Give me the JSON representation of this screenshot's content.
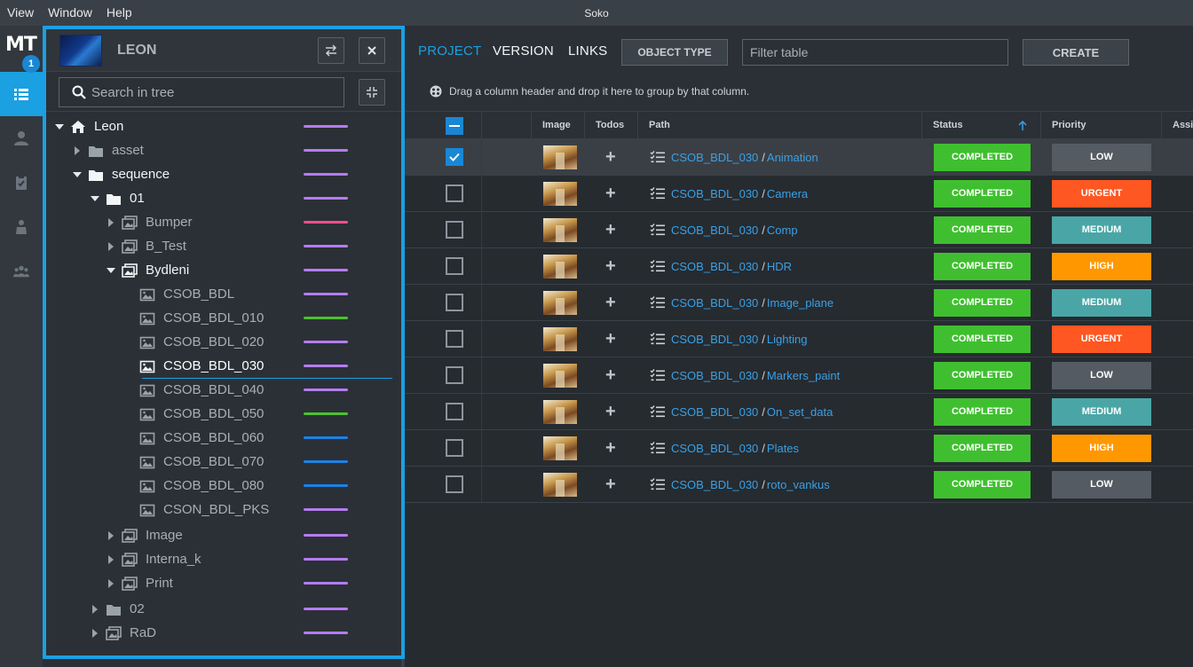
{
  "menubar": {
    "items": [
      "View",
      "Window",
      "Help"
    ],
    "app_title": "Soko"
  },
  "rail": {
    "logo": "MT",
    "badge": "1",
    "icons": [
      "list-icon",
      "user-icon",
      "clipboard-icon",
      "person-icon",
      "group-icon"
    ]
  },
  "tree_panel": {
    "title": "LEON",
    "search_placeholder": "Search in tree",
    "nodes": [
      {
        "label": "Leon",
        "depth": 0,
        "arrow": "down",
        "icon": "home",
        "bar": "#b57cf0",
        "style": "bright"
      },
      {
        "label": "asset",
        "depth": 1,
        "arrow": "right",
        "icon": "folder",
        "bar": "#b57cf0",
        "style": "dim"
      },
      {
        "label": "sequence",
        "depth": 1,
        "arrow": "down",
        "icon": "folder",
        "bar": "#b57cf0",
        "style": "bright"
      },
      {
        "label": "01",
        "depth": 2,
        "arrow": "down",
        "icon": "folder",
        "bar": "#b57cf0",
        "style": "bright"
      },
      {
        "label": "Bumper",
        "depth": 3,
        "arrow": "right",
        "icon": "images",
        "bar": "#f0508a",
        "style": "dim"
      },
      {
        "label": "B_Test",
        "depth": 3,
        "arrow": "right",
        "icon": "images",
        "bar": "#b57cf0",
        "style": "dim"
      },
      {
        "label": "Bydleni",
        "depth": 3,
        "arrow": "down",
        "icon": "images",
        "bar": "#b57cf0",
        "style": "bright"
      },
      {
        "label": "CSOB_BDL",
        "depth": 4,
        "arrow": "",
        "icon": "image",
        "bar": "#b57cf0",
        "style": "dim"
      },
      {
        "label": "CSOB_BDL_010",
        "depth": 4,
        "arrow": "",
        "icon": "image",
        "bar": "#4ec12f",
        "style": "dim"
      },
      {
        "label": "CSOB_BDL_020",
        "depth": 4,
        "arrow": "",
        "icon": "image",
        "bar": "#b57cf0",
        "style": "dim"
      },
      {
        "label": "CSOB_BDL_030",
        "depth": 4,
        "arrow": "",
        "icon": "image",
        "bar": "#b57cf0",
        "style": "selected"
      },
      {
        "label": "CSOB_BDL_040",
        "depth": 4,
        "arrow": "",
        "icon": "image",
        "bar": "#b57cf0",
        "style": "dim"
      },
      {
        "label": "CSOB_BDL_050",
        "depth": 4,
        "arrow": "",
        "icon": "image",
        "bar": "#4ec12f",
        "style": "dim"
      },
      {
        "label": "CSOB_BDL_060",
        "depth": 4,
        "arrow": "",
        "icon": "image",
        "bar": "#1c82e6",
        "style": "dim"
      },
      {
        "label": "CSOB_BDL_070",
        "depth": 4,
        "arrow": "",
        "icon": "image",
        "bar": "#1c82e6",
        "style": "dim"
      },
      {
        "label": "CSOB_BDL_080",
        "depth": 4,
        "arrow": "",
        "icon": "image",
        "bar": "#1c82e6",
        "style": "dim"
      },
      {
        "label": "CSON_BDL_PKS",
        "depth": 4,
        "arrow": "",
        "icon": "image",
        "bar": "#b57cf0",
        "style": "dim"
      },
      {
        "label": "Image",
        "depth": 3,
        "arrow": "right",
        "icon": "images",
        "bar": "#b57cf0",
        "style": "dim"
      },
      {
        "label": "Interna_k",
        "depth": 3,
        "arrow": "right",
        "icon": "images",
        "bar": "#b57cf0",
        "style": "dim"
      },
      {
        "label": "Print",
        "depth": 3,
        "arrow": "right",
        "icon": "images",
        "bar": "#b57cf0",
        "style": "dim"
      },
      {
        "label": "02",
        "depth": 2,
        "arrow": "right",
        "icon": "folder",
        "bar": "#b57cf0",
        "style": "dim"
      },
      {
        "label": "RaD",
        "depth": 2,
        "arrow": "right",
        "icon": "images",
        "bar": "#b57cf0",
        "style": "dim"
      }
    ]
  },
  "main": {
    "tabs": [
      {
        "label": "PROJECT",
        "active": true
      },
      {
        "label": "VERSION",
        "active": false
      },
      {
        "label": "LINKS",
        "active": false
      }
    ],
    "object_type_label": "OBJECT TYPE",
    "filter_placeholder": "Filter table",
    "create_label": "CREATE",
    "group_hint": "Drag a column header and drop it here to group by that column.",
    "columns": [
      "Image",
      "Todos",
      "Path",
      "Status",
      "Priority",
      "Assi"
    ],
    "rows": [
      {
        "path_parent": "CSOB_BDL_030",
        "path_child": "Animation",
        "status": "COMPLETED",
        "priority": "LOW",
        "checked": true
      },
      {
        "path_parent": "CSOB_BDL_030",
        "path_child": "Camera",
        "status": "COMPLETED",
        "priority": "URGENT",
        "checked": false
      },
      {
        "path_parent": "CSOB_BDL_030",
        "path_child": "Comp",
        "status": "COMPLETED",
        "priority": "MEDIUM",
        "checked": false
      },
      {
        "path_parent": "CSOB_BDL_030",
        "path_child": "HDR",
        "status": "COMPLETED",
        "priority": "HIGH",
        "checked": false
      },
      {
        "path_parent": "CSOB_BDL_030",
        "path_child": "Image_plane",
        "status": "COMPLETED",
        "priority": "MEDIUM",
        "checked": false
      },
      {
        "path_parent": "CSOB_BDL_030",
        "path_child": "Lighting",
        "status": "COMPLETED",
        "priority": "URGENT",
        "checked": false
      },
      {
        "path_parent": "CSOB_BDL_030",
        "path_child": "Markers_paint",
        "status": "COMPLETED",
        "priority": "LOW",
        "checked": false
      },
      {
        "path_parent": "CSOB_BDL_030",
        "path_child": "On_set_data",
        "status": "COMPLETED",
        "priority": "MEDIUM",
        "checked": false
      },
      {
        "path_parent": "CSOB_BDL_030",
        "path_child": "Plates",
        "status": "COMPLETED",
        "priority": "HIGH",
        "checked": false
      },
      {
        "path_parent": "CSOB_BDL_030",
        "path_child": "roto_vankus",
        "status": "COMPLETED",
        "priority": "LOW",
        "checked": false
      }
    ]
  },
  "colors": {
    "accent": "#1ba0e2",
    "status_completed": "#3fbf2f",
    "priority_low": "#545b62",
    "priority_urgent": "#ff5722",
    "priority_medium": "#4aa6a6",
    "priority_high": "#ff9800"
  }
}
